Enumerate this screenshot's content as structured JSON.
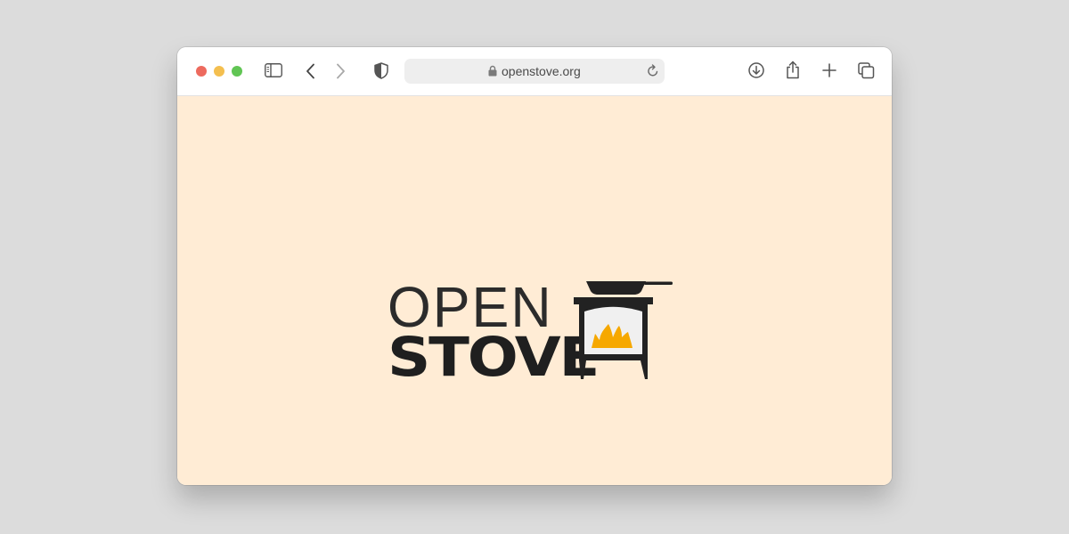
{
  "browser": {
    "address_bar": {
      "url": "openstove.org"
    },
    "traffic_lights": {
      "close": "#ed6a5e",
      "minimize": "#f4bf4f",
      "zoom": "#61c554"
    },
    "toolbar_icons": [
      "sidebar-icon",
      "back-icon",
      "forward-icon",
      "shield-icon",
      "lock-icon",
      "reload-icon",
      "download-icon",
      "share-icon",
      "plus-icon",
      "tabs-icon"
    ]
  },
  "page": {
    "background": "#ffecd5",
    "logo": {
      "line1": "OPEN",
      "line2": "STOVE",
      "text_color": "#222222",
      "flame_color": "#f6a800",
      "window_color": "#f0f0f0"
    }
  }
}
